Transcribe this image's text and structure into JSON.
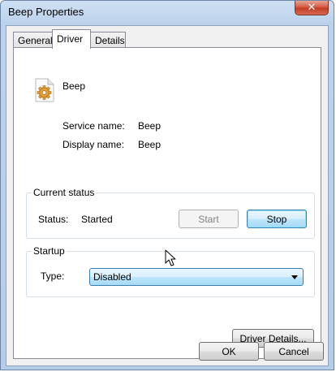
{
  "window": {
    "title": "Beep Properties",
    "close_glyph": "✕"
  },
  "tabs": [
    {
      "label": "General",
      "active": false
    },
    {
      "label": "Driver",
      "active": true
    },
    {
      "label": "Details",
      "active": false
    }
  ],
  "driver": {
    "icon": "service-gear-icon",
    "name": "Beep",
    "service_name_label": "Service name:",
    "service_name_value": "Beep",
    "display_name_label": "Display name:",
    "display_name_value": "Beep"
  },
  "current_status": {
    "legend": "Current status",
    "status_label": "Status:",
    "status_value": "Started",
    "start_label": "Start",
    "stop_label": "Stop"
  },
  "startup": {
    "legend": "Startup",
    "type_label": "Type:",
    "type_value": "Disabled"
  },
  "driver_details_label": "Driver Details...",
  "ok_label": "OK",
  "cancel_label": "Cancel",
  "colors": {
    "title_bar": "#bcd2ec",
    "close_button": "#c13a21",
    "focus_border": "#3c7fb1",
    "focus_fill": "#bee6fd"
  }
}
